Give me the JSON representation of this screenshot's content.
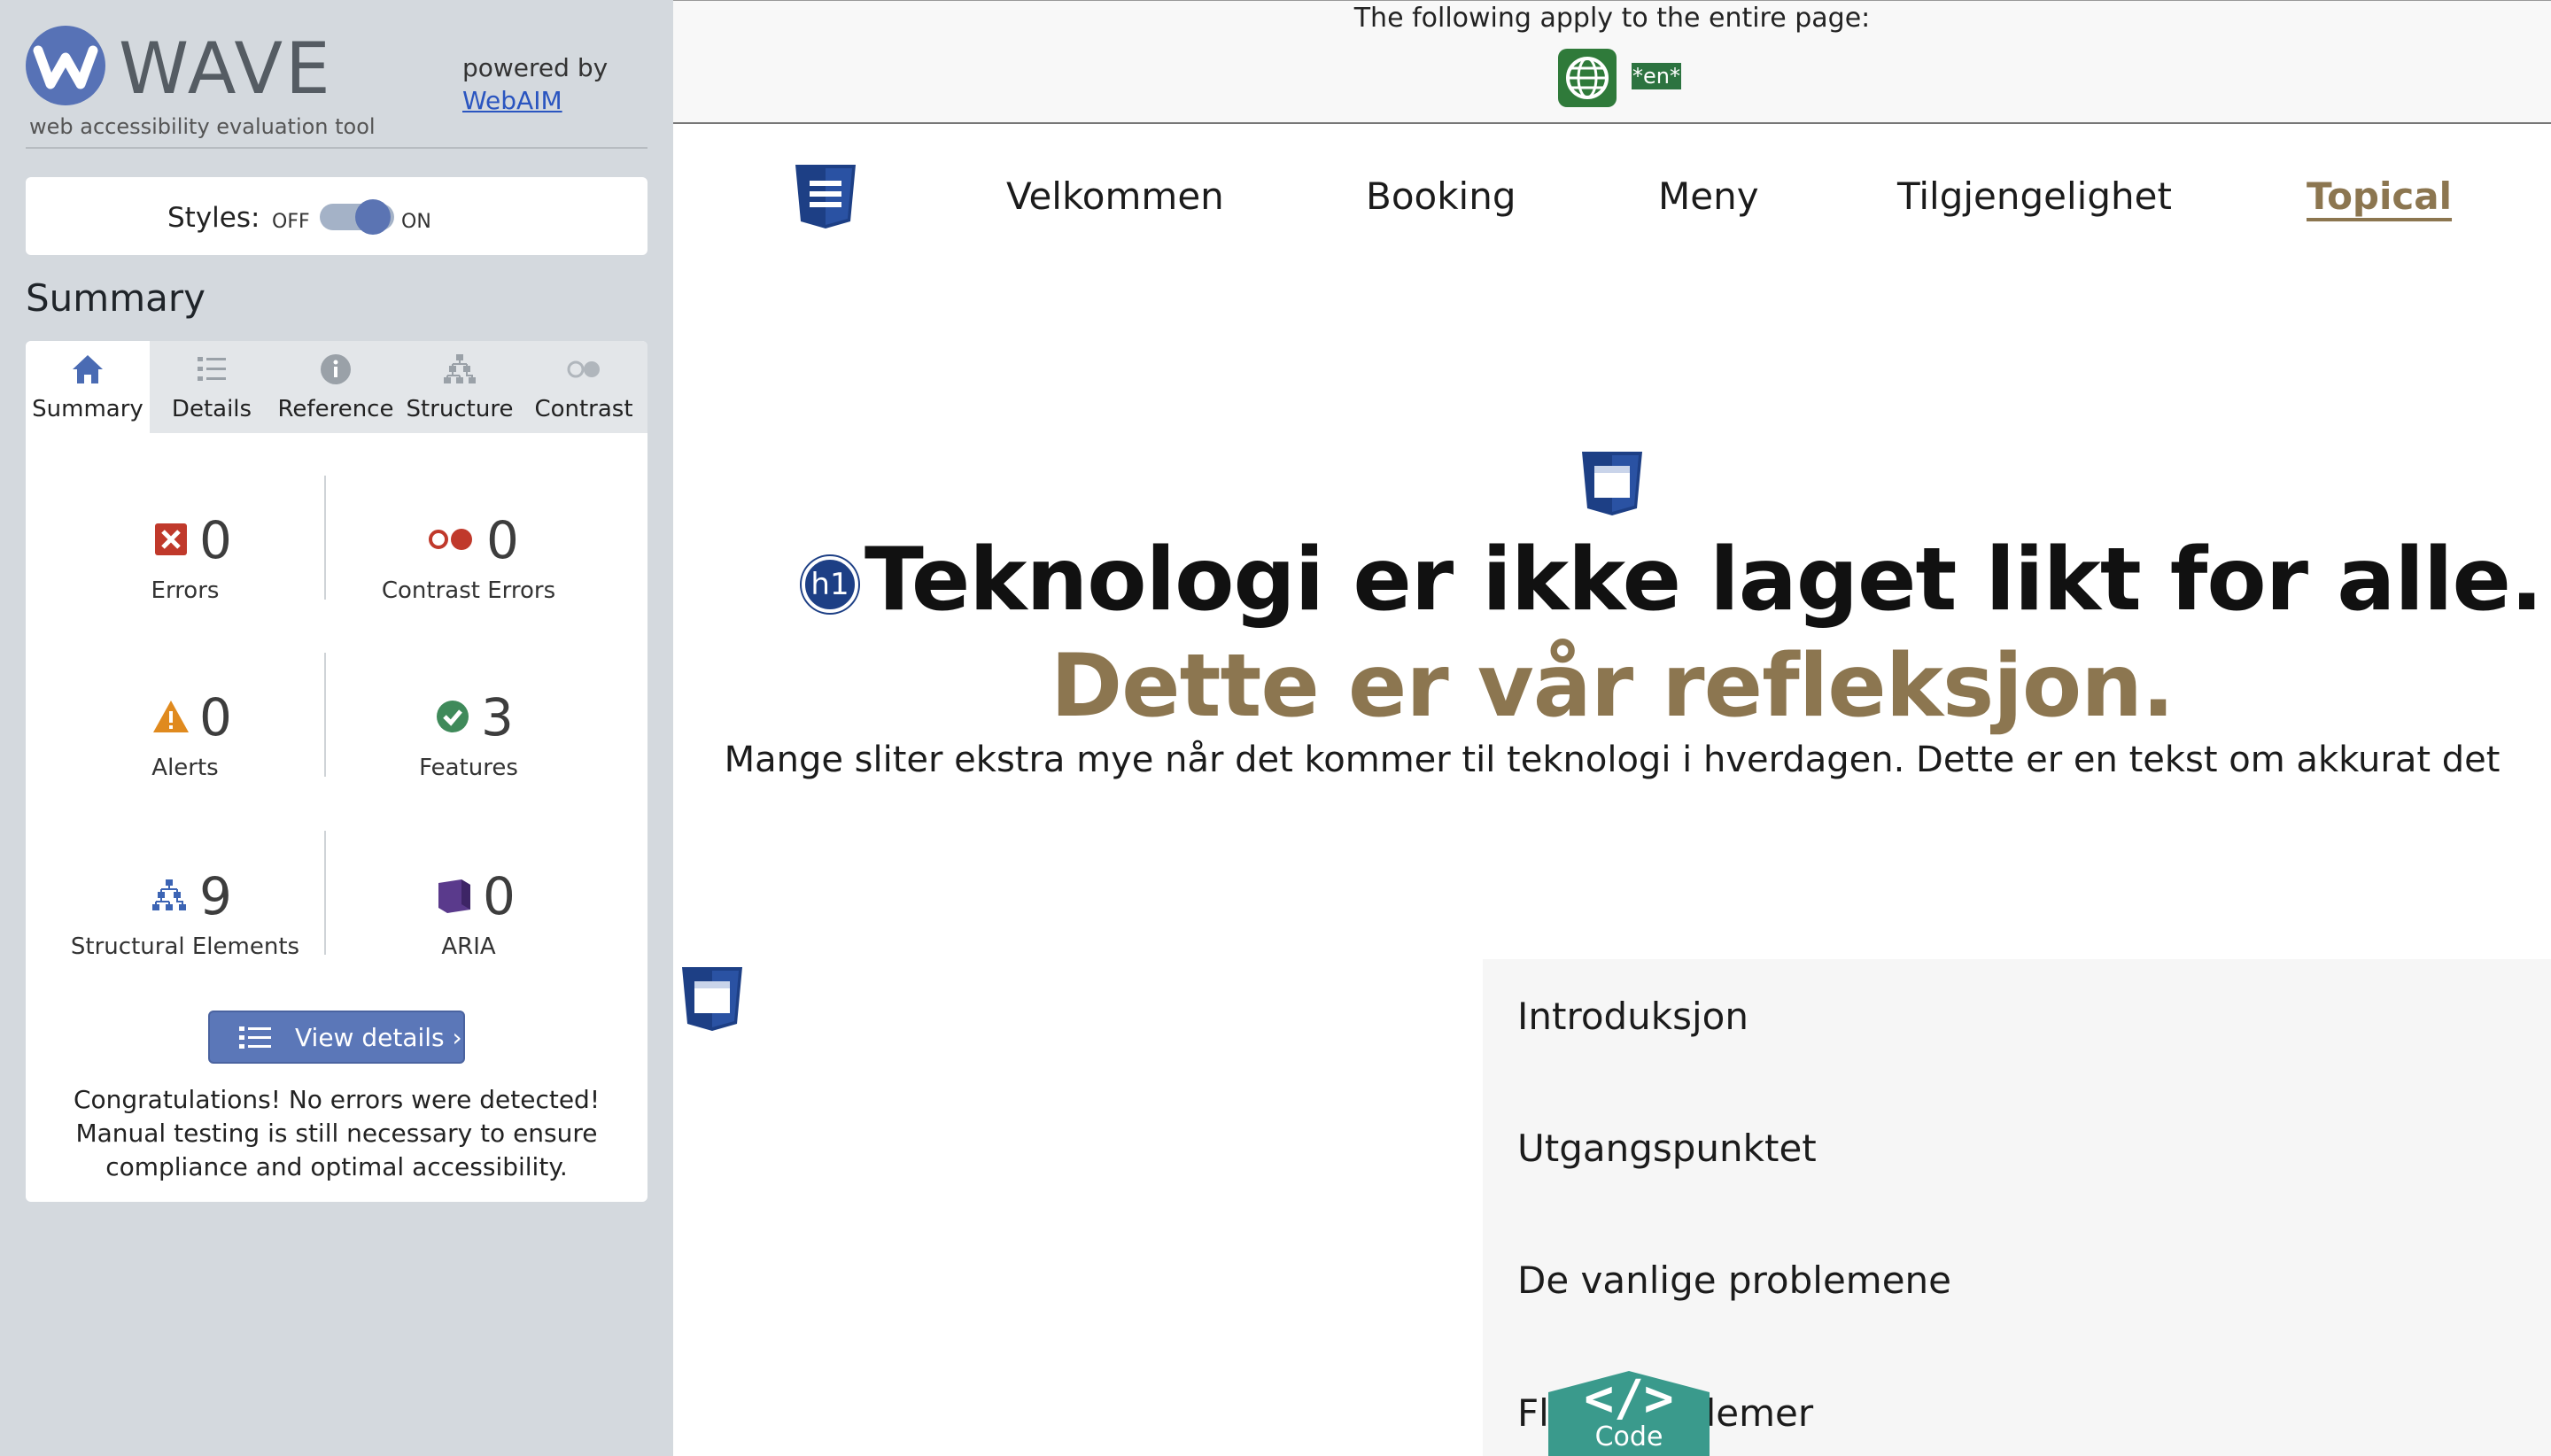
{
  "wave": {
    "logo_text": "WAVE",
    "tagline": "web accessibility evaluation tool",
    "powered_by": "powered by",
    "webaim_link": "WebAIM"
  },
  "styles_toggle": {
    "label": "Styles:",
    "off": "OFF",
    "on": "ON",
    "state": "on"
  },
  "summary_heading": "Summary",
  "tabs": [
    {
      "label": "Summary",
      "icon": "home-icon",
      "active": true
    },
    {
      "label": "Details",
      "icon": "list-icon",
      "active": false
    },
    {
      "label": "Reference",
      "icon": "info-icon",
      "active": false
    },
    {
      "label": "Structure",
      "icon": "structure-icon",
      "active": false
    },
    {
      "label": "Contrast",
      "icon": "contrast-icon",
      "active": false
    }
  ],
  "stats": {
    "errors": {
      "count": "0",
      "label": "Errors"
    },
    "contrast_errors": {
      "count": "0",
      "label": "Contrast Errors"
    },
    "alerts": {
      "count": "0",
      "label": "Alerts"
    },
    "features": {
      "count": "3",
      "label": "Features"
    },
    "structural": {
      "count": "9",
      "label": "Structural Elements"
    },
    "aria": {
      "count": "0",
      "label": "ARIA"
    }
  },
  "view_details_label": "View details ›",
  "congrats_text": "Congratulations! No errors were detected! Manual testing is still necessary to ensure compliance and optimal accessibility.",
  "page_banner": {
    "text": "The following apply to the entire page:",
    "lang_badge": "*en*"
  },
  "site_nav": [
    {
      "label": "Velkommen",
      "active": false
    },
    {
      "label": "Booking",
      "active": false
    },
    {
      "label": "Meny",
      "active": false
    },
    {
      "label": "Tilgjengelighet",
      "active": false
    },
    {
      "label": "Topical",
      "active": true
    }
  ],
  "hero": {
    "h1_badge": "h1",
    "title": "Teknologi er ikke laget likt for alle.",
    "subtitle": "Dette er vår refleksjon.",
    "intro": "Mange sliter ekstra mye når det kommer til teknologi i hverdagen. Dette er en tekst om akkurat det"
  },
  "toc": [
    "Introduksjon",
    "Utgangspunktet",
    "De vanlige problemene",
    "Flere problemer"
  ],
  "code_tab": {
    "glyph": "</>",
    "label": "Code"
  },
  "colors": {
    "wave_blue": "#5b77b8",
    "sidebar_bg": "#d4d9de",
    "accent_brown": "#8c7650",
    "code_tab": "#3a9a8c",
    "html5_badge": "#1d3f85"
  }
}
